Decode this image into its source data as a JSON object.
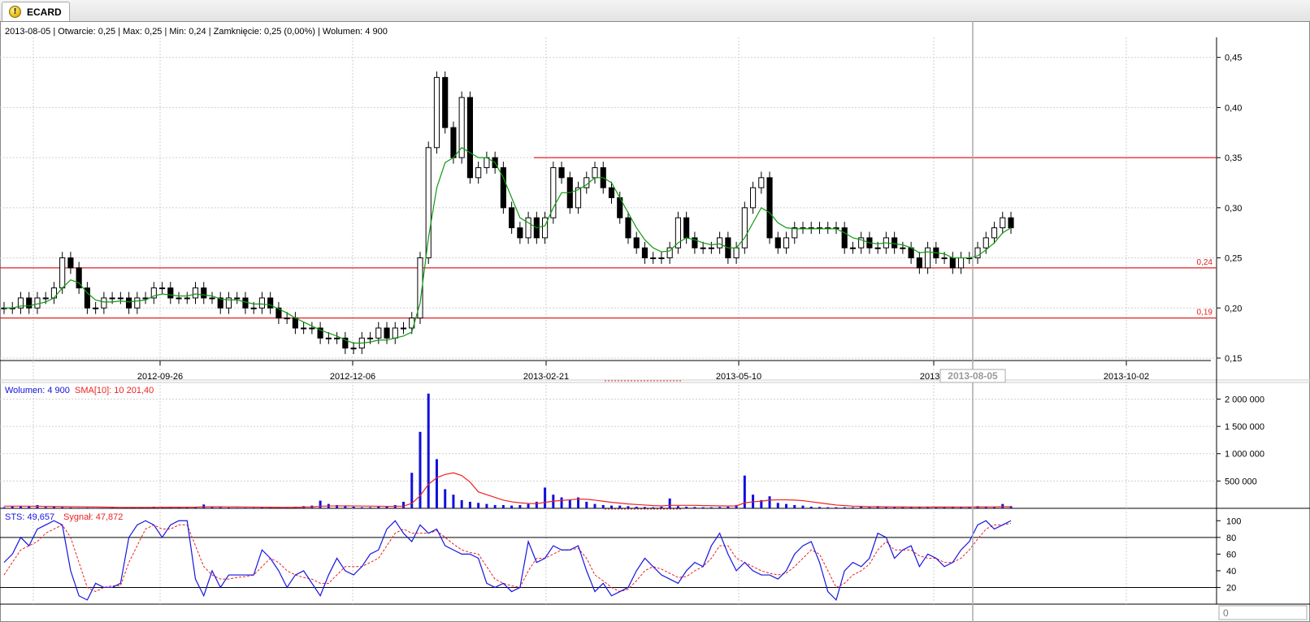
{
  "window": {
    "tab_title": "ECARD",
    "tab_icon": "warning-icon"
  },
  "colors": {
    "candle": "#000000",
    "ma_line": "#119911",
    "support_lines": "#e02020",
    "volume_bars": "#1010dd",
    "volume_sma": "#ee2222",
    "sts_line": "#1515e0",
    "signal_line": "#e82222",
    "crosshair": "#aaaaaa",
    "grid": "#cfcfcf"
  },
  "chart_data": [
    {
      "type": "candlestick",
      "info_text": "2013-08-05 | Otwarcie: 0,25 | Max: 0,25 | Min: 0,24 | Zamknięcie: 0,25 (0,00%)  | Wolumen: 4 900",
      "ylim": [
        0.15,
        0.47
      ],
      "y_ticks": [
        "0,15",
        "0,20",
        "0,25",
        "0,30",
        "0,35",
        "0,40",
        "0,45"
      ],
      "x_ticks": [
        "2012-09-26",
        "2012-12-06",
        "2013-02-21",
        "2013-05-10",
        "2013-0",
        "2013-10-02"
      ],
      "crosshair_label": "2013-08-05",
      "horizontal_lines": [
        {
          "value": 0.35,
          "label": ""
        },
        {
          "value": 0.24,
          "label": "0,24"
        },
        {
          "value": 0.19,
          "label": "0,19"
        }
      ],
      "closes": [
        0.2,
        0.2,
        0.21,
        0.2,
        0.21,
        0.21,
        0.22,
        0.25,
        0.24,
        0.22,
        0.2,
        0.2,
        0.21,
        0.21,
        0.21,
        0.2,
        0.21,
        0.21,
        0.22,
        0.22,
        0.21,
        0.21,
        0.21,
        0.22,
        0.21,
        0.21,
        0.2,
        0.21,
        0.21,
        0.2,
        0.2,
        0.21,
        0.2,
        0.19,
        0.19,
        0.18,
        0.18,
        0.18,
        0.17,
        0.17,
        0.17,
        0.16,
        0.16,
        0.17,
        0.17,
        0.18,
        0.17,
        0.18,
        0.18,
        0.19,
        0.25,
        0.36,
        0.43,
        0.38,
        0.35,
        0.41,
        0.33,
        0.34,
        0.35,
        0.34,
        0.3,
        0.28,
        0.27,
        0.29,
        0.27,
        0.29,
        0.34,
        0.33,
        0.3,
        0.32,
        0.33,
        0.34,
        0.32,
        0.31,
        0.29,
        0.27,
        0.26,
        0.25,
        0.25,
        0.25,
        0.26,
        0.29,
        0.27,
        0.26,
        0.26,
        0.26,
        0.27,
        0.25,
        0.26,
        0.3,
        0.32,
        0.33,
        0.27,
        0.26,
        0.27,
        0.28,
        0.28,
        0.28,
        0.28,
        0.28,
        0.28,
        0.26,
        0.26,
        0.27,
        0.26,
        0.26,
        0.27,
        0.26,
        0.26,
        0.25,
        0.24,
        0.26,
        0.25,
        0.25,
        0.24,
        0.25,
        0.25,
        0.26,
        0.27,
        0.28,
        0.29,
        0.28
      ],
      "ma": [
        0.2,
        0.2,
        0.202,
        0.202,
        0.204,
        0.206,
        0.21,
        0.22,
        0.228,
        0.225,
        0.215,
        0.208,
        0.206,
        0.206,
        0.207,
        0.206,
        0.207,
        0.208,
        0.212,
        0.214,
        0.213,
        0.212,
        0.212,
        0.214,
        0.213,
        0.212,
        0.209,
        0.208,
        0.208,
        0.206,
        0.204,
        0.204,
        0.203,
        0.199,
        0.195,
        0.19,
        0.186,
        0.182,
        0.178,
        0.175,
        0.172,
        0.168,
        0.165,
        0.165,
        0.166,
        0.168,
        0.168,
        0.17,
        0.172,
        0.176,
        0.205,
        0.27,
        0.32,
        0.345,
        0.35,
        0.36,
        0.355,
        0.35,
        0.35,
        0.345,
        0.33,
        0.31,
        0.29,
        0.285,
        0.28,
        0.282,
        0.3,
        0.315,
        0.315,
        0.318,
        0.323,
        0.33,
        0.33,
        0.325,
        0.31,
        0.295,
        0.28,
        0.268,
        0.26,
        0.256,
        0.257,
        0.265,
        0.27,
        0.268,
        0.265,
        0.263,
        0.264,
        0.26,
        0.26,
        0.27,
        0.285,
        0.3,
        0.295,
        0.285,
        0.28,
        0.279,
        0.279,
        0.279,
        0.279,
        0.279,
        0.279,
        0.275,
        0.27,
        0.268,
        0.265,
        0.264,
        0.265,
        0.264,
        0.263,
        0.26,
        0.255,
        0.256,
        0.255,
        0.254,
        0.25,
        0.25,
        0.25,
        0.252,
        0.258,
        0.265,
        0.275,
        0.28
      ]
    },
    {
      "type": "bar",
      "label": "Wolumen: 4 900",
      "sma_label": "SMA[10]: 10 201,40",
      "ylim": [
        0,
        2200000
      ],
      "y_ticks": [
        "500 000",
        "1 000 000",
        "1 500 000",
        "2 000 000"
      ],
      "values": [
        20000,
        35000,
        40000,
        30000,
        60000,
        25000,
        30000,
        20000,
        15000,
        10000,
        12000,
        8000,
        10000,
        15000,
        12000,
        10000,
        20000,
        15000,
        30000,
        25000,
        20000,
        18000,
        15000,
        22000,
        70000,
        30000,
        20000,
        15000,
        10000,
        12000,
        12000,
        15000,
        15000,
        20000,
        25000,
        30000,
        40000,
        50000,
        140000,
        80000,
        60000,
        40000,
        30000,
        20000,
        20000,
        30000,
        40000,
        60000,
        120000,
        650000,
        1400000,
        2100000,
        900000,
        350000,
        250000,
        150000,
        120000,
        100000,
        80000,
        60000,
        60000,
        50000,
        60000,
        80000,
        120000,
        380000,
        250000,
        200000,
        150000,
        200000,
        120000,
        80000,
        60000,
        50000,
        50000,
        40000,
        30000,
        25000,
        20000,
        30000,
        180000,
        40000,
        30000,
        25000,
        20000,
        20000,
        25000,
        30000,
        60000,
        600000,
        250000,
        150000,
        220000,
        100000,
        80000,
        60000,
        50000,
        30000,
        25000,
        20000,
        20000,
        20000,
        20000,
        30000,
        20000,
        40000,
        20000,
        30000,
        20000,
        30000,
        20000,
        20000,
        20000,
        20000,
        30000,
        20000,
        20000,
        40000,
        25000,
        20000,
        80000,
        40000
      ],
      "sma": [
        40000,
        40000,
        40000,
        38000,
        38000,
        36000,
        34000,
        32000,
        30000,
        28000,
        26000,
        24000,
        22000,
        20000,
        18000,
        17000,
        17000,
        17000,
        18000,
        19000,
        20000,
        20000,
        21000,
        22000,
        27000,
        28000,
        28000,
        27000,
        26000,
        25000,
        23000,
        21000,
        20000,
        19000,
        18000,
        19000,
        22000,
        26000,
        38000,
        42000,
        44000,
        45000,
        44000,
        42000,
        40000,
        38000,
        36000,
        36000,
        40000,
        90000,
        230000,
        440000,
        560000,
        620000,
        650000,
        600000,
        480000,
        300000,
        250000,
        200000,
        150000,
        120000,
        100000,
        90000,
        85000,
        110000,
        130000,
        145000,
        155000,
        170000,
        165000,
        150000,
        130000,
        110000,
        95000,
        80000,
        70000,
        60000,
        50000,
        45000,
        55000,
        55000,
        55000,
        55000,
        50000,
        48000,
        45000,
        43000,
        45000,
        100000,
        120000,
        130000,
        150000,
        155000,
        155000,
        150000,
        140000,
        120000,
        100000,
        80000,
        60000,
        50000,
        40000,
        35000,
        30000,
        30000,
        28000,
        27000,
        26000,
        25000,
        25000,
        25000,
        24000,
        24000,
        25000,
        25000,
        25000,
        26000,
        27000,
        27000,
        30000,
        30000
      ]
    },
    {
      "type": "line",
      "label": "STS: 49,657",
      "signal_label": "Sygnał: 47,872",
      "ylim": [
        0,
        110
      ],
      "y_ticks": [
        "20",
        "40",
        "60",
        "80",
        "100"
      ],
      "levels": [
        20,
        80
      ],
      "scroll_value": "0",
      "sts": [
        50,
        60,
        80,
        70,
        90,
        95,
        100,
        95,
        40,
        10,
        5,
        25,
        20,
        20,
        25,
        80,
        95,
        100,
        95,
        80,
        95,
        100,
        100,
        30,
        10,
        40,
        20,
        35,
        35,
        35,
        35,
        65,
        55,
        40,
        20,
        35,
        40,
        25,
        10,
        35,
        55,
        40,
        35,
        45,
        60,
        65,
        90,
        100,
        85,
        75,
        95,
        85,
        90,
        70,
        65,
        60,
        60,
        55,
        25,
        20,
        25,
        15,
        20,
        75,
        50,
        55,
        70,
        65,
        65,
        70,
        40,
        15,
        25,
        10,
        15,
        20,
        40,
        55,
        45,
        35,
        30,
        25,
        40,
        50,
        45,
        70,
        85,
        60,
        40,
        50,
        40,
        35,
        35,
        30,
        40,
        60,
        70,
        75,
        50,
        15,
        5,
        40,
        50,
        45,
        55,
        85,
        80,
        55,
        65,
        70,
        45,
        60,
        55,
        45,
        50,
        65,
        75,
        95,
        100,
        90,
        95,
        100
      ],
      "signal": [
        35,
        50,
        65,
        70,
        75,
        85,
        90,
        95,
        80,
        50,
        20,
        15,
        20,
        22,
        22,
        50,
        70,
        90,
        95,
        90,
        90,
        95,
        95,
        70,
        45,
        35,
        30,
        30,
        32,
        33,
        35,
        45,
        55,
        50,
        40,
        35,
        32,
        30,
        25,
        25,
        35,
        45,
        45,
        45,
        50,
        55,
        70,
        85,
        90,
        85,
        85,
        85,
        88,
        80,
        72,
        65,
        62,
        60,
        45,
        30,
        25,
        22,
        20,
        40,
        55,
        55,
        60,
        65,
        65,
        67,
        55,
        35,
        28,
        20,
        15,
        18,
        28,
        40,
        45,
        42,
        37,
        32,
        33,
        40,
        45,
        55,
        70,
        70,
        55,
        50,
        45,
        40,
        37,
        35,
        37,
        45,
        55,
        65,
        60,
        40,
        20,
        25,
        35,
        40,
        48,
        65,
        75,
        65,
        65,
        65,
        58,
        55,
        55,
        50,
        50,
        55,
        65,
        78,
        90,
        95,
        95,
        97
      ]
    }
  ]
}
